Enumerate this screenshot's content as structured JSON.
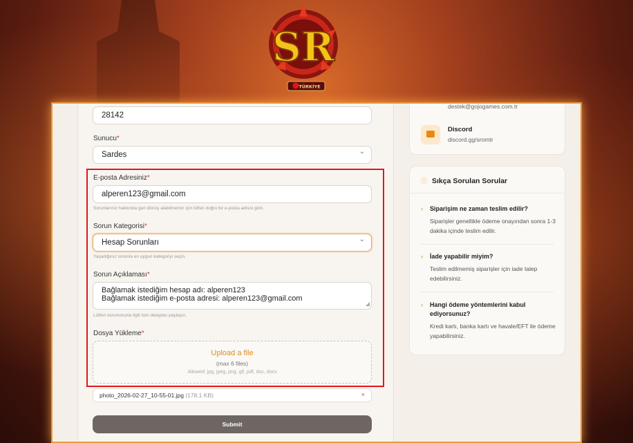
{
  "brand": {
    "logo_text": "SR",
    "logo_banner": "TÜRKİYE"
  },
  "form": {
    "zip_value": "28142",
    "server_label": "Sunucu",
    "server_value": "Sardes",
    "email_label": "E-posta Adresiniz",
    "email_value": "alperen123@gmail.com",
    "email_hint": "Sorunlarınız hakkında geri dönüş alabilmemiz için lütfen doğru bir e-posta adresi girin.",
    "category_label": "Sorun Kategorisi",
    "category_value": "Hesap Sorunları",
    "category_hint": "Yaşadığınız sorunla en uygun kategoriyi seçin.",
    "desc_label": "Sorun Açıklaması",
    "desc_line1": "Bağlamak istediğim hesap adı: alperen123",
    "desc_line2": "Bağlamak istediğim e-posta adresi: alperen123@gmail.com",
    "desc_hint": "Lütfen sorununuzla ilgili tüm detayları paylaşın.",
    "upload_label": "Dosya Yükleme",
    "upload_link": "Upload a file",
    "upload_max": "(max 6 files)",
    "upload_allowed": "Allowed: jpg, jpeg, png, gif, pdf, doc, docx",
    "file_name": "photo_2026-02-27_10-55-01.jpg",
    "file_size": "(178.1 KB)",
    "remove_glyph": "×",
    "submit_label": "Submit",
    "required_mark": "*"
  },
  "contact": {
    "email_partial": "destek@gojogames.com.tr",
    "discord_title": "Discord",
    "discord_link": "discord.gg/sromtr"
  },
  "faq": {
    "title": "Sıkça Sorulan Sorular",
    "items": [
      {
        "q": "Siparişim ne zaman teslim edilir?",
        "a": "Siparişler genellikle ödeme onayından sonra 1-3 dakika içinde teslim edilir."
      },
      {
        "q": "İade yapabilir miyim?",
        "a": "Teslim edilmemiş siparişler için iade talep edebilirsiniz."
      },
      {
        "q": "Hangi ödeme yöntemlerini kabul ediyorsunuz?",
        "a": "Kredi kartı, banka kartı ve havale/EFT ile ödeme yapabilirsiniz."
      }
    ]
  },
  "colors": {
    "accent": "#e8a02a",
    "highlight": "#e0161c",
    "submit_bg": "#6d6662"
  },
  "icons": {
    "discord": "discord-icon",
    "faq": "question-circle-icon",
    "chevron": "chevron-right-icon"
  }
}
